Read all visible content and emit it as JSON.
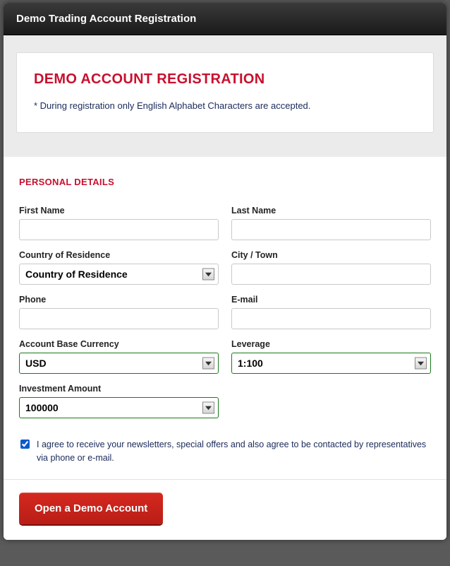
{
  "title": "Demo Trading Account Registration",
  "info": {
    "heading": "DEMO ACCOUNT REGISTRATION",
    "note": "* During registration only English Alphabet Characters are accepted."
  },
  "section_heading": "PERSONAL DETAILS",
  "fields": {
    "first_name": {
      "label": "First Name",
      "value": ""
    },
    "last_name": {
      "label": "Last Name",
      "value": ""
    },
    "country": {
      "label": "Country of Residence",
      "selected": "Country of Residence"
    },
    "city": {
      "label": "City / Town",
      "value": ""
    },
    "phone": {
      "label": "Phone",
      "value": ""
    },
    "email": {
      "label": "E-mail",
      "value": ""
    },
    "currency": {
      "label": "Account Base Currency",
      "selected": "USD"
    },
    "leverage": {
      "label": "Leverage",
      "selected": "1:100"
    },
    "investment": {
      "label": "Investment Amount",
      "selected": "100000"
    }
  },
  "consent": {
    "checked": true,
    "text": "I agree to receive your newsletters, special offers and also agree to be contacted by representatives via phone or e-mail."
  },
  "submit_label": "Open a Demo Account"
}
